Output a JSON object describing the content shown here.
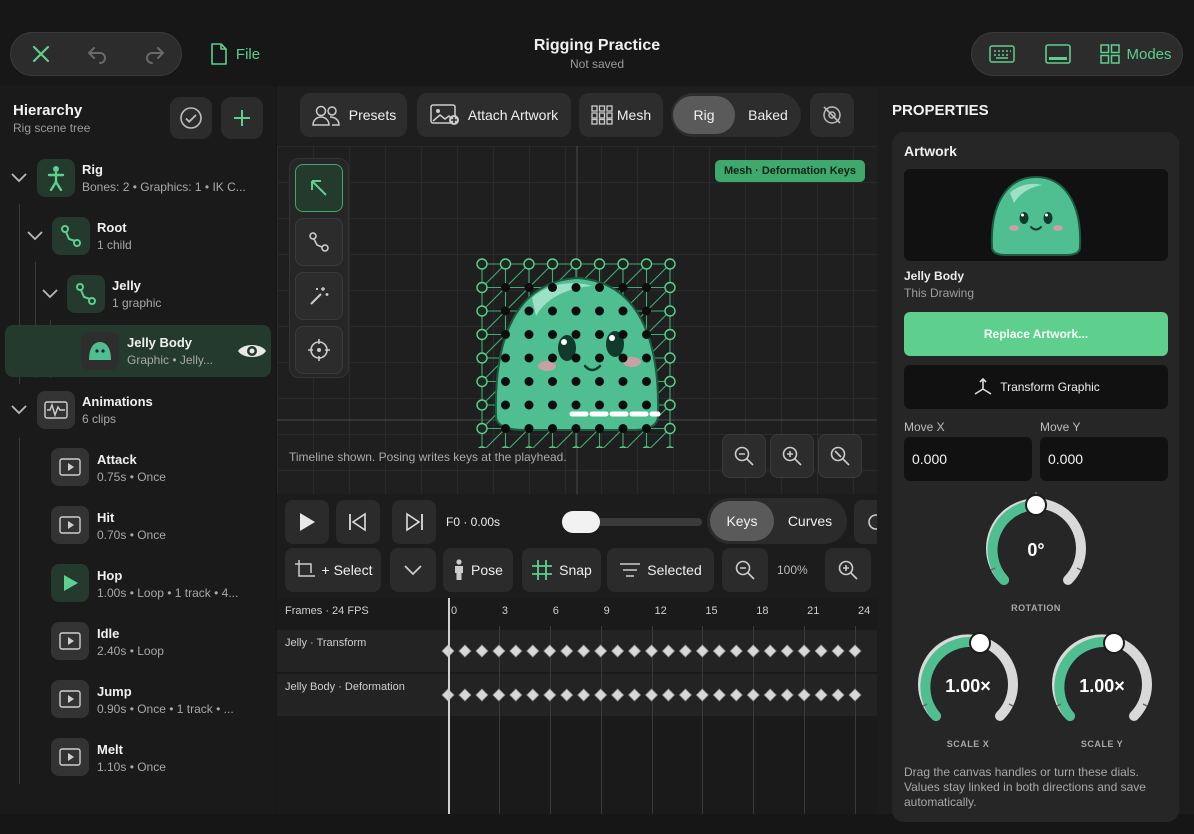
{
  "topbar": {
    "file_label": "File",
    "title": "Rigging Practice",
    "subtitle": "Not saved",
    "modes_label": "Modes"
  },
  "hierarchy": {
    "title": "Hierarchy",
    "subtitle": "Rig scene tree",
    "nodes": [
      {
        "title": "Rig",
        "meta": "Bones: 2  •  Graphics: 1  •  IK C..."
      },
      {
        "title": "Root",
        "meta": "1 child"
      },
      {
        "title": "Jelly",
        "meta": "1 graphic"
      },
      {
        "title": "Jelly Body",
        "meta": "Graphic  •  Jelly..."
      }
    ],
    "animations": {
      "title": "Animations",
      "meta": "6 clips"
    },
    "clips": [
      {
        "title": "Attack",
        "meta": "0.75s  •  Once"
      },
      {
        "title": "Hit",
        "meta": "0.70s  •  Once"
      },
      {
        "title": "Hop",
        "meta": "1.00s  •  Loop  •  1 track  •  4..."
      },
      {
        "title": "Idle",
        "meta": "2.40s  •  Loop"
      },
      {
        "title": "Jump",
        "meta": "0.90s  •  Once  •  1 track  •  ..."
      },
      {
        "title": "Melt",
        "meta": "1.10s  •  Once"
      }
    ]
  },
  "toolbar": {
    "presets": "Presets",
    "attach": "Attach Artwork",
    "mesh": "Mesh",
    "rig": "Rig",
    "baked": "Baked"
  },
  "canvas": {
    "badge": "Mesh · Deformation Keys",
    "hint": "Timeline shown. Posing writes keys at the playhead."
  },
  "playback": {
    "frame_readout": "F0 · 0.00s",
    "progress": 0,
    "keys": "Keys",
    "curves": "Curves",
    "select": "+ Select",
    "pose": "Pose",
    "snap": "Snap",
    "selected": "Selected",
    "zoom": "100%"
  },
  "timeline": {
    "header": "Frames · 24 FPS",
    "frames": [
      "0",
      "3",
      "6",
      "9",
      "12",
      "15",
      "18",
      "21",
      "24"
    ],
    "tracks": [
      "Jelly · Transform",
      "Jelly Body · Deformation"
    ],
    "keys_per_track": 25
  },
  "properties": {
    "title": "PROPERTIES",
    "section": "Artwork",
    "art_name": "Jelly Body",
    "art_source": "This Drawing",
    "replace": "Replace Artwork...",
    "transform": "Transform Graphic",
    "move_x_label": "Move X",
    "move_y_label": "Move Y",
    "move_x": "0.000",
    "move_y": "0.000",
    "rotation_value": "0°",
    "rotation_label": "ROTATION",
    "scale_x_value": "1.00×",
    "scale_x_label": "SCALE X",
    "scale_y_value": "1.00×",
    "scale_y_label": "SCALE Y",
    "help": "Drag the canvas handles or turn these dials. Values stay linked in both directions and save automatically."
  },
  "colors": {
    "accent": "#5fcf8e",
    "jelly": "#4fbf92"
  }
}
